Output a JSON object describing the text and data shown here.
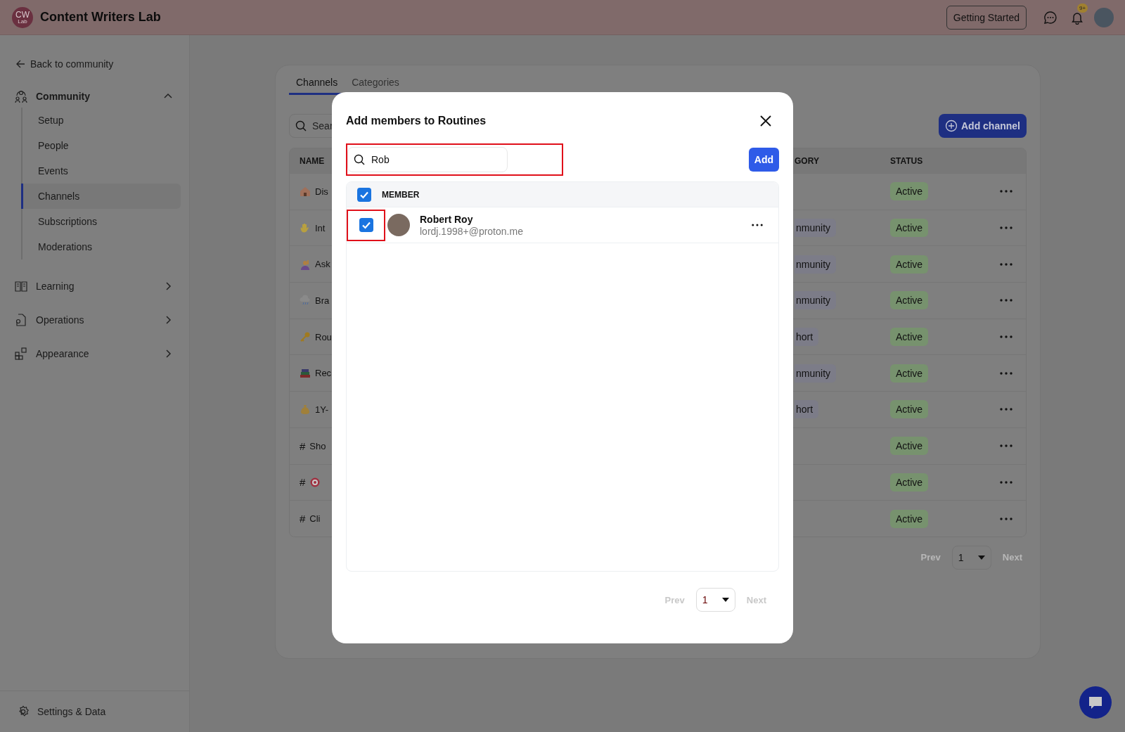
{
  "header": {
    "logo": {
      "initials": "CW",
      "sub": "Lab"
    },
    "title": "Content Writers Lab",
    "getting_started": "Getting Started",
    "notification_badge": "9+"
  },
  "sidebar": {
    "back": "Back to community",
    "sections": [
      {
        "label": "Community",
        "kind": "community",
        "expanded": true,
        "children": [
          {
            "label": "Setup",
            "selected": false
          },
          {
            "label": "People",
            "selected": false
          },
          {
            "label": "Events",
            "selected": false
          },
          {
            "label": "Channels",
            "selected": true
          },
          {
            "label": "Subscriptions",
            "selected": false
          },
          {
            "label": "Moderations",
            "selected": false
          }
        ]
      },
      {
        "label": "Learning",
        "kind": "learning",
        "expanded": false
      },
      {
        "label": "Operations",
        "kind": "operations",
        "expanded": false
      },
      {
        "label": "Appearance",
        "kind": "appearance",
        "expanded": false
      }
    ],
    "footer": "Settings & Data"
  },
  "channels_page": {
    "tabs": [
      {
        "label": "Channels",
        "selected": true
      },
      {
        "label": "Categories",
        "selected": false
      }
    ],
    "search": {
      "placeholder": "Sear"
    },
    "add_button": "Add channel",
    "columns": [
      "NAME",
      "GORY",
      "STATUS"
    ],
    "rows": [
      {
        "kind": "house",
        "name": "Dis",
        "status": "Active"
      },
      {
        "kind": "wave",
        "name": "Int",
        "category": "nmunity",
        "status": "Active"
      },
      {
        "kind": "person",
        "name": "Ask",
        "category": "nmunity",
        "status": "Active"
      },
      {
        "kind": "storm",
        "name": "Bra",
        "category": "nmunity",
        "status": "Active"
      },
      {
        "kind": "key",
        "name": "Rou",
        "category": "hort",
        "status": "Active"
      },
      {
        "kind": "books",
        "name": "Rec",
        "category": "nmunity",
        "status": "Active"
      },
      {
        "kind": "moneybag",
        "name": "1Y-",
        "category": "hort",
        "status": "Active"
      },
      {
        "prefix": "#",
        "name": "Sho",
        "status": "Active"
      },
      {
        "prefix": "#",
        "kind": "target",
        "status": "Active"
      },
      {
        "prefix": "#",
        "name": "Cli",
        "status": "Active"
      }
    ],
    "pagination": {
      "prev": "Prev",
      "page": "1",
      "next": "Next"
    }
  },
  "modal": {
    "title": "Add members to Routines",
    "search": {
      "value": "Rob",
      "highlighted": true
    },
    "add_button": "Add",
    "header_checked": true,
    "column": "MEMBER",
    "members": [
      {
        "name": "Robert Roy",
        "email": "lordj.1998+@proton.me",
        "checked": true,
        "highlighted": true
      }
    ],
    "pagination": {
      "prev": "Prev",
      "page": "1",
      "next": "Next"
    }
  }
}
